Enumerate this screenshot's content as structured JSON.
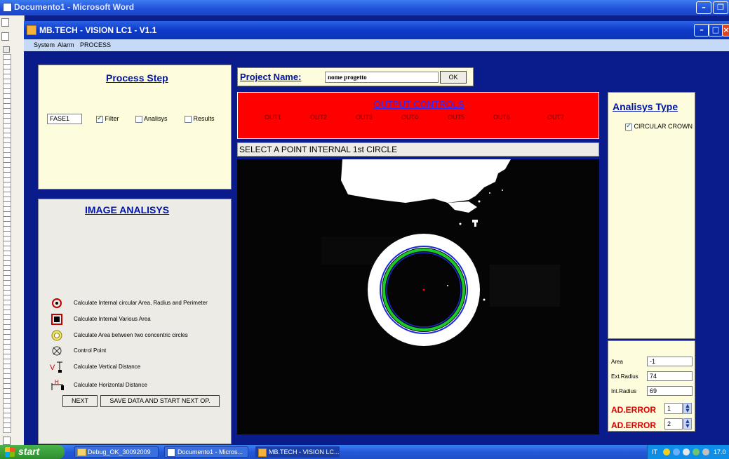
{
  "word": {
    "title": "Documento1 - Microsoft Word"
  },
  "app": {
    "title": "MB.TECH - VISION LC1 - V1.1",
    "menu": [
      "System",
      "Alarm",
      "PROCESS"
    ]
  },
  "process_step": {
    "title": "Process Step",
    "phase_value": "FASE1",
    "checkboxes": [
      {
        "label": "Filter",
        "checked": true
      },
      {
        "label": "Analisys",
        "checked": false
      },
      {
        "label": "Results",
        "checked": false
      }
    ]
  },
  "project": {
    "label": "Project Name:",
    "value": "nome progetto",
    "ok_label": "OK"
  },
  "output_controls": {
    "title": "OUTPUT CONTROLS",
    "outputs": [
      "OUT1",
      "OUT2",
      "OUT3",
      "OUT4",
      "OUT5",
      "OUT6",
      "OUT7"
    ],
    "bg_color": "#ff0000"
  },
  "status_message": "SELECT A POINT INTERNAL 1st CIRCLE",
  "image_analisys": {
    "title": "IMAGE ANALISYS",
    "tools": [
      {
        "icon": "target-circle-icon",
        "label": "Calculate Internal circular Area, Radius and Perimeter"
      },
      {
        "icon": "filled-square-icon",
        "label": "Calculate Internal Various Area"
      },
      {
        "icon": "concentric-circles-icon",
        "label": "Calculate Area between two concentric circles"
      },
      {
        "icon": "control-point-icon",
        "label": "Control Point"
      },
      {
        "icon": "vertical-distance-icon",
        "label": "Calculate Vertical Distance"
      },
      {
        "icon": "horizontal-distance-icon",
        "label": "Calculate Horizontal Distance"
      }
    ],
    "next_label": "NEXT",
    "save_label": "SAVE DATA AND START NEXT OP."
  },
  "analisys_type": {
    "title": "Analisys Type",
    "option": {
      "label": "CIRCULAR CROWN",
      "checked": true
    },
    "bg_color": "#ff0000"
  },
  "results": {
    "area_label": "Area",
    "area_value": "-1",
    "ext_radius_label": "Ext.Radius",
    "ext_radius_value": "74",
    "int_radius_label": "Int.Radius",
    "int_radius_value": "69",
    "ad_error_1_label": "AD.ERROR",
    "ad_error_1_value": "1",
    "ad_error_2_label": "AD.ERROR",
    "ad_error_2_value": "2"
  },
  "taskbar": {
    "start_label": "start",
    "tasks": [
      "Debug_OK_30092009",
      "Documento1 - Micros...",
      "MB.TECH - VISION LC..."
    ],
    "tray_text": "IT",
    "clock": "17.0"
  }
}
